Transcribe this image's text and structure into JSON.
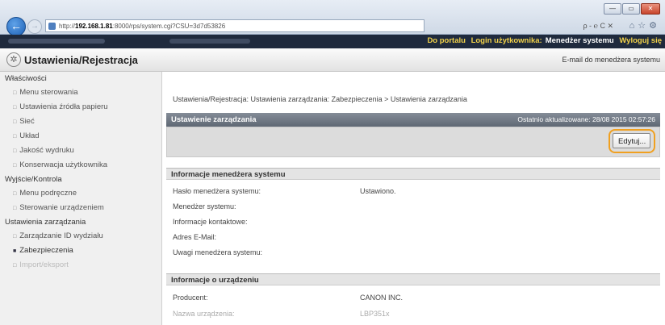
{
  "browser": {
    "address_prefix": "http://",
    "address_host": "192.168.1.81",
    "address_rest": ":8000/rps/system.cgi?CSU=3d7d53826",
    "search_text": "ρ - ℮ C ✕",
    "window_buttons": [
      "—",
      "▭",
      "✕"
    ]
  },
  "header": {
    "portal_link": "Do portalu",
    "login_label": "Login użytkownika:",
    "login_user": "Menedżer systemu",
    "logout_link": "Wyloguj się"
  },
  "titlebar": {
    "title": "Ustawienia/Rejestracja",
    "email_link": "E-mail do menedżera systemu"
  },
  "sidebar": {
    "sections": [
      {
        "title": "Właściwości",
        "items": [
          "Menu sterowania",
          "Ustawienia źródła papieru",
          "Sieć",
          "Układ",
          "Jakość wydruku",
          "Konserwacja użytkownika"
        ]
      },
      {
        "title": "Wyjście/Kontrola",
        "items": [
          "Menu podręczne",
          "Sterowanie urządzeniem"
        ]
      },
      {
        "title": "Ustawienia zarządzania",
        "items": [
          "Zarządzanie ID wydziału",
          "Zabezpieczenia",
          "Import/eksport"
        ]
      }
    ],
    "active_item": "Zabezpieczenia"
  },
  "main": {
    "breadcrumb": "Ustawienia/Rejestracja: Ustawienia zarządzania: Zabezpieczenia > Ustawienia zarządzania",
    "panel_title": "Ustawienie zarządzania",
    "updated": "Ostatnio aktualizowane: 28/08 2015 02:57:26",
    "edit_button": "Edytuj...",
    "manager_section": {
      "title": "Informacje menedżera systemu",
      "rows": [
        {
          "label": "Hasło menedżera systemu:",
          "value": "Ustawiono."
        },
        {
          "label": "Menedżer systemu:",
          "value": ""
        },
        {
          "label": "Informacje kontaktowe:",
          "value": ""
        },
        {
          "label": "Adres E-Mail:",
          "value": ""
        },
        {
          "label": "Uwagi menedżera systemu:",
          "value": ""
        }
      ]
    },
    "device_section": {
      "title": "Informacje o urządzeniu",
      "rows": [
        {
          "label": "Producent:",
          "value": "CANON INC."
        },
        {
          "label": "Nazwa urządzenia:",
          "value": "LBP351x"
        }
      ]
    }
  }
}
